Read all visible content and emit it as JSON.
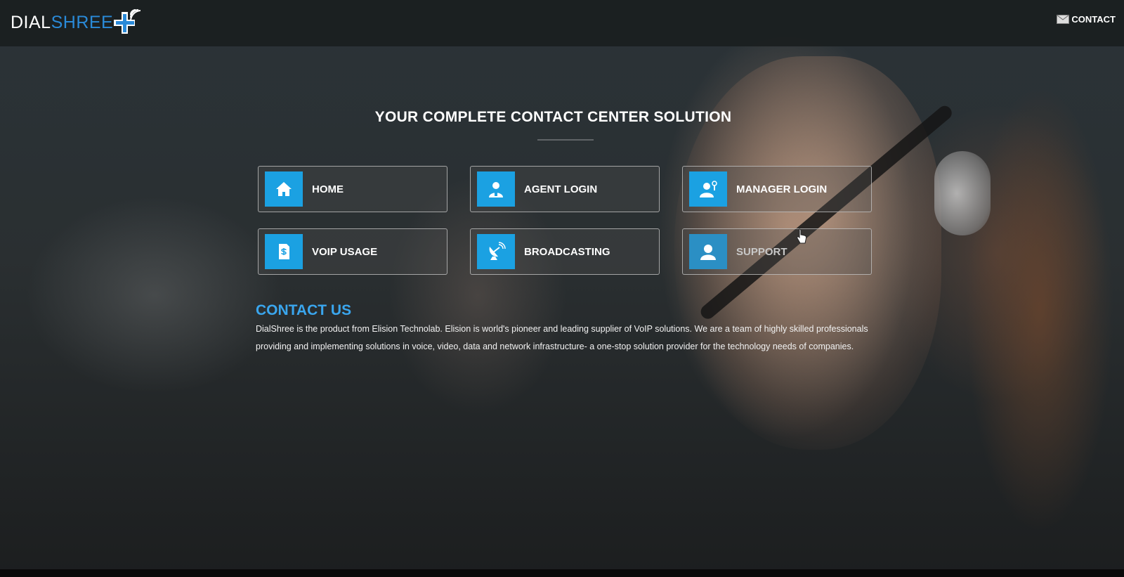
{
  "header": {
    "logo_part1": "DIAL",
    "logo_part2": "SHREE",
    "contact_link": "CONTACT"
  },
  "hero": {
    "title": "YOUR COMPLETE CONTACT CENTER SOLUTION"
  },
  "tiles": [
    {
      "label": "HOME",
      "icon": "home-icon"
    },
    {
      "label": "AGENT LOGIN",
      "icon": "agent-icon"
    },
    {
      "label": "MANAGER LOGIN",
      "icon": "manager-icon"
    },
    {
      "label": "VOIP USAGE",
      "icon": "document-dollar-icon"
    },
    {
      "label": "BROADCASTING",
      "icon": "satellite-dish-icon"
    },
    {
      "label": "SUPPORT",
      "icon": "support-person-icon"
    }
  ],
  "contact": {
    "title": "CONTACT US",
    "text": "DialShree is the product from Elision Technolab. Elision is world's pioneer and leading supplier of VoIP solutions. We are a team of highly skilled professionals providing and implementing solutions in voice, video, data and network infrastructure- a one-stop solution provider for the technology needs of companies."
  },
  "colors": {
    "accent": "#1ba1e2",
    "contact_title": "#3aa6ee",
    "header_bg": "#1a1e20",
    "logo_blue": "#2a8ad8"
  }
}
